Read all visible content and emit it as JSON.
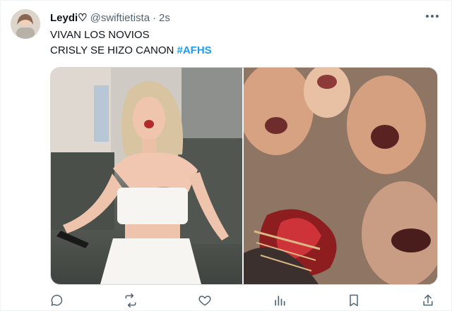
{
  "tweet": {
    "display_name": "Leydi♡",
    "handle": "@swiftietista",
    "separator": "·",
    "timestamp": "2s",
    "text_line1": "VIVAN LOS NOVIOS",
    "text_line2_prefix": "CRISLY SE HIZO CANON ",
    "hashtag": "#AFHS"
  },
  "icons": {
    "more": "more-horizontal-icon",
    "reply": "reply-icon",
    "retweet": "retweet-icon",
    "like": "heart-icon",
    "views": "analytics-icon",
    "bookmark": "bookmark-icon",
    "share": "share-icon"
  },
  "colors": {
    "accent": "#1d9bf0",
    "secondary_text": "#536471",
    "border": "#cfd9de"
  }
}
